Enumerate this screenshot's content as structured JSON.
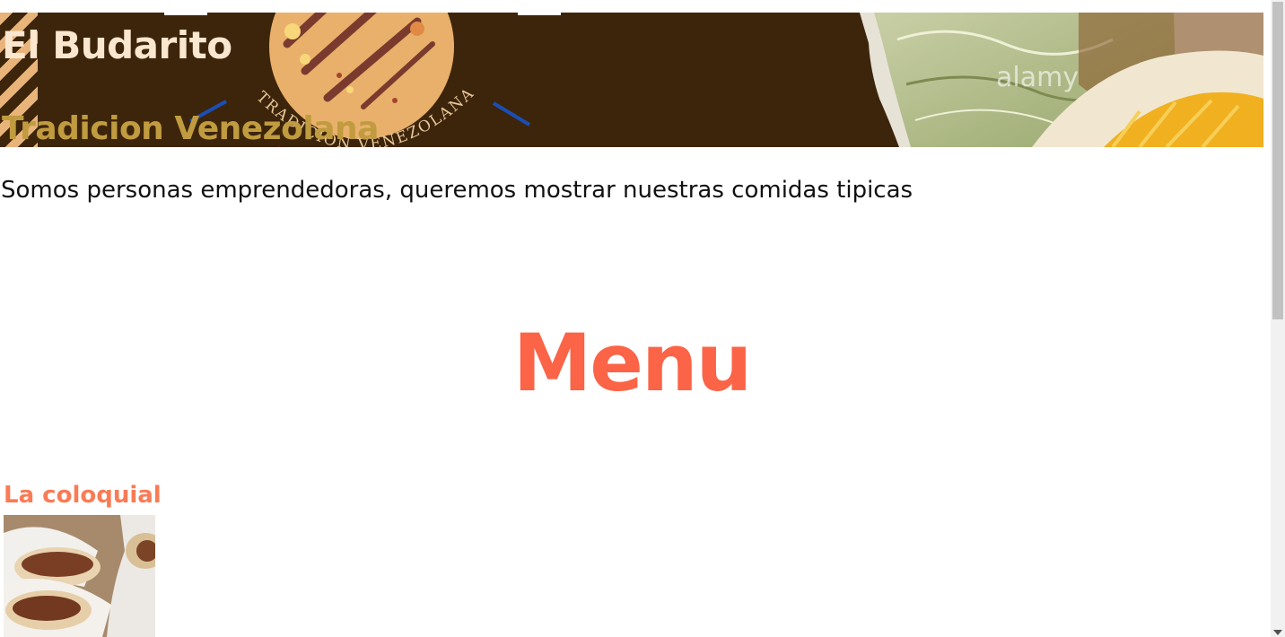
{
  "header": {
    "title": "El Budarito",
    "subtitle": "Tradicion Venezolana",
    "logo_arc_text": "TRADICION VENEZOLANA",
    "photo_watermark": "alamy"
  },
  "intro": {
    "text": "Somos personas emprendedoras, queremos mostrar nuestras comidas tipicas"
  },
  "menu": {
    "heading": "Menu",
    "items": [
      {
        "name": "La coloquial"
      }
    ]
  },
  "colors": {
    "banner_bg": "#3d250b",
    "title": "#fbe6cf",
    "subtitle": "#c09b3f",
    "menu_heading": "#fb6447",
    "item_title": "#fa7b55"
  }
}
